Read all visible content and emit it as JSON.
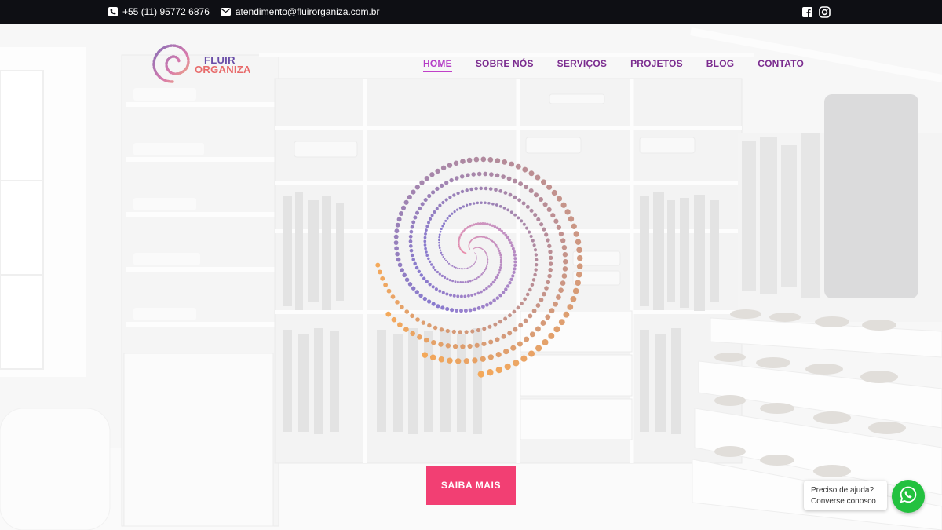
{
  "topbar": {
    "phone": "+55 (11) 95772 6876",
    "email": "atendimento@fluirorganiza.com.br",
    "icons": [
      "phone-icon",
      "mail-icon",
      "facebook-icon",
      "instagram-icon"
    ]
  },
  "brand": {
    "name_line1": "FLUIR",
    "name_line2": "ORGANIZA"
  },
  "nav": {
    "items": [
      {
        "label": "HOME",
        "active": true
      },
      {
        "label": "SOBRE NÓS",
        "active": false
      },
      {
        "label": "SERVIÇOS",
        "active": false
      },
      {
        "label": "PROJETOS",
        "active": false
      },
      {
        "label": "BLOG",
        "active": false
      },
      {
        "label": "CONTATO",
        "active": false
      }
    ]
  },
  "hero": {
    "cta_label": "SAIBA MAIS"
  },
  "whatsapp": {
    "line1": "Preciso de ajuda?",
    "line2": "Converse conosco"
  },
  "colors": {
    "topbar_bg": "#0e0f14",
    "nav_text": "#7b2c8f",
    "nav_active": "#b43cc6",
    "cta_bg": "#f23f73",
    "whatsapp_green": "#23c13f"
  }
}
